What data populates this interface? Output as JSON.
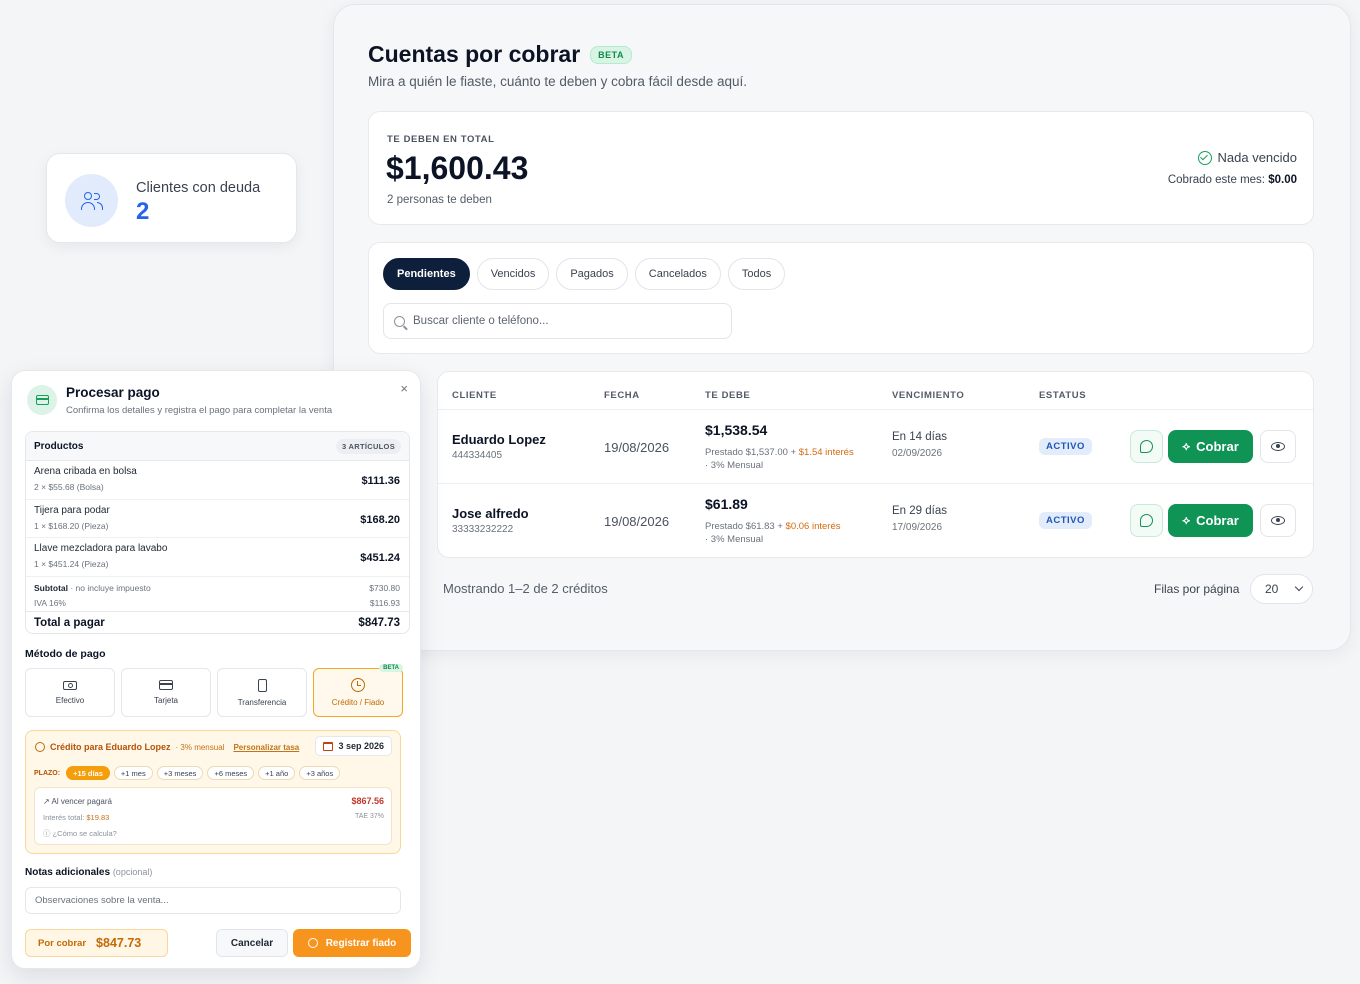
{
  "header": {
    "title": "Cuentas por cobrar",
    "beta": "BETA",
    "subtitle": "Mira a quién le fiaste, cuánto te deben y cobra fácil desde aquí."
  },
  "summary": {
    "label": "TE DEBEN EN TOTAL",
    "amount": "$1,600.43",
    "people": "2 personas te deben",
    "status": "Nada vencido",
    "cobrado_label": "Cobrado este mes:",
    "cobrado_value": "$0.00"
  },
  "tabs": [
    "Pendientes",
    "Vencidos",
    "Pagados",
    "Cancelados",
    "Todos"
  ],
  "search": {
    "placeholder": "Buscar cliente o teléfono..."
  },
  "table": {
    "headers": [
      "CLIENTE",
      "FECHA",
      "TE DEBE",
      "VENCIMIENTO",
      "ESTATUS"
    ],
    "rows": [
      {
        "name": "Eduardo Lopez",
        "phone": "444334405",
        "fecha": "19/08/2026",
        "amount": "$1,538.54",
        "prestado": "Prestado $1,537.00 + ",
        "interes": "$1.54 interés",
        "mensual": "· 3% Mensual",
        "venc": "En 14 días",
        "venc_date": "02/09/2026",
        "status": "ACTIVO",
        "cobrar": "Cobrar"
      },
      {
        "name": "Jose alfredo",
        "phone": "33333232222",
        "fecha": "19/08/2026",
        "amount": "$61.89",
        "prestado": "Prestado $61.83 + ",
        "interes": "$0.06 interés",
        "mensual": "· 3% Mensual",
        "venc": "En 29 días",
        "venc_date": "17/09/2026",
        "status": "ACTIVO",
        "cobrar": "Cobrar"
      }
    ]
  },
  "pagination": {
    "showing": "Mostrando 1–2 de 2 créditos",
    "filas_label": "Filas por página",
    "filas_value": "20"
  },
  "clients_card": {
    "label": "Clientes con deuda",
    "value": "2"
  },
  "modal": {
    "title": "Procesar pago",
    "subtitle": "Confirma los detalles y registra el pago para completar la venta",
    "close": "×",
    "productos_label": "Productos",
    "productos_count": "3 ARTÍCULOS",
    "items": [
      {
        "name": "Arena cribada en bolsa",
        "detail": "2 × $55.68 (Bolsa)",
        "price": "$111.36"
      },
      {
        "name": "Tijera para podar",
        "detail": "1 × $168.20 (Pieza)",
        "price": "$168.20"
      },
      {
        "name": "Llave mezcladora para lavabo",
        "detail": "1 × $451.24 (Pieza)",
        "price": "$451.24"
      }
    ],
    "subtotal_label": "Subtotal",
    "subtotal_note": " · no incluye impuesto",
    "subtotal_value": "$730.80",
    "iva_label": "IVA 16%",
    "iva_value": "$116.93",
    "total_label": "Total a pagar",
    "total_value": "$847.73",
    "metodo_label": "Método de pago",
    "methods": [
      "Efectivo",
      "Tarjeta",
      "Transferencia",
      "Crédito / Fiado"
    ],
    "method_beta": "BETA",
    "credit": {
      "title": "Crédito para Eduardo Lopez",
      "rate": "· 3% mensual",
      "personalizar": "Personalizar tasa",
      "date": "3 sep 2026",
      "plazo_label": "PLAZO:",
      "plazos": [
        "+15 días",
        "+1 mes",
        "+3 meses",
        "+6 meses",
        "+1 año",
        "+3 años"
      ],
      "al_vencer": "Al vencer pagará",
      "al_vencer_value": "$867.56",
      "interes_label": "Interés total: ",
      "interes_value": "$19.83",
      "tae": "TAE 37%",
      "como": "¿Cómo se calcula?"
    },
    "notas_label": "Notas adicionales",
    "notas_optional": "(opcional)",
    "notas_placeholder": "Observaciones sobre la venta...",
    "por_cobrar_label": "Por cobrar",
    "por_cobrar_value": "$847.73",
    "cancel": "Cancelar",
    "registrar": "Registrar fiado"
  }
}
